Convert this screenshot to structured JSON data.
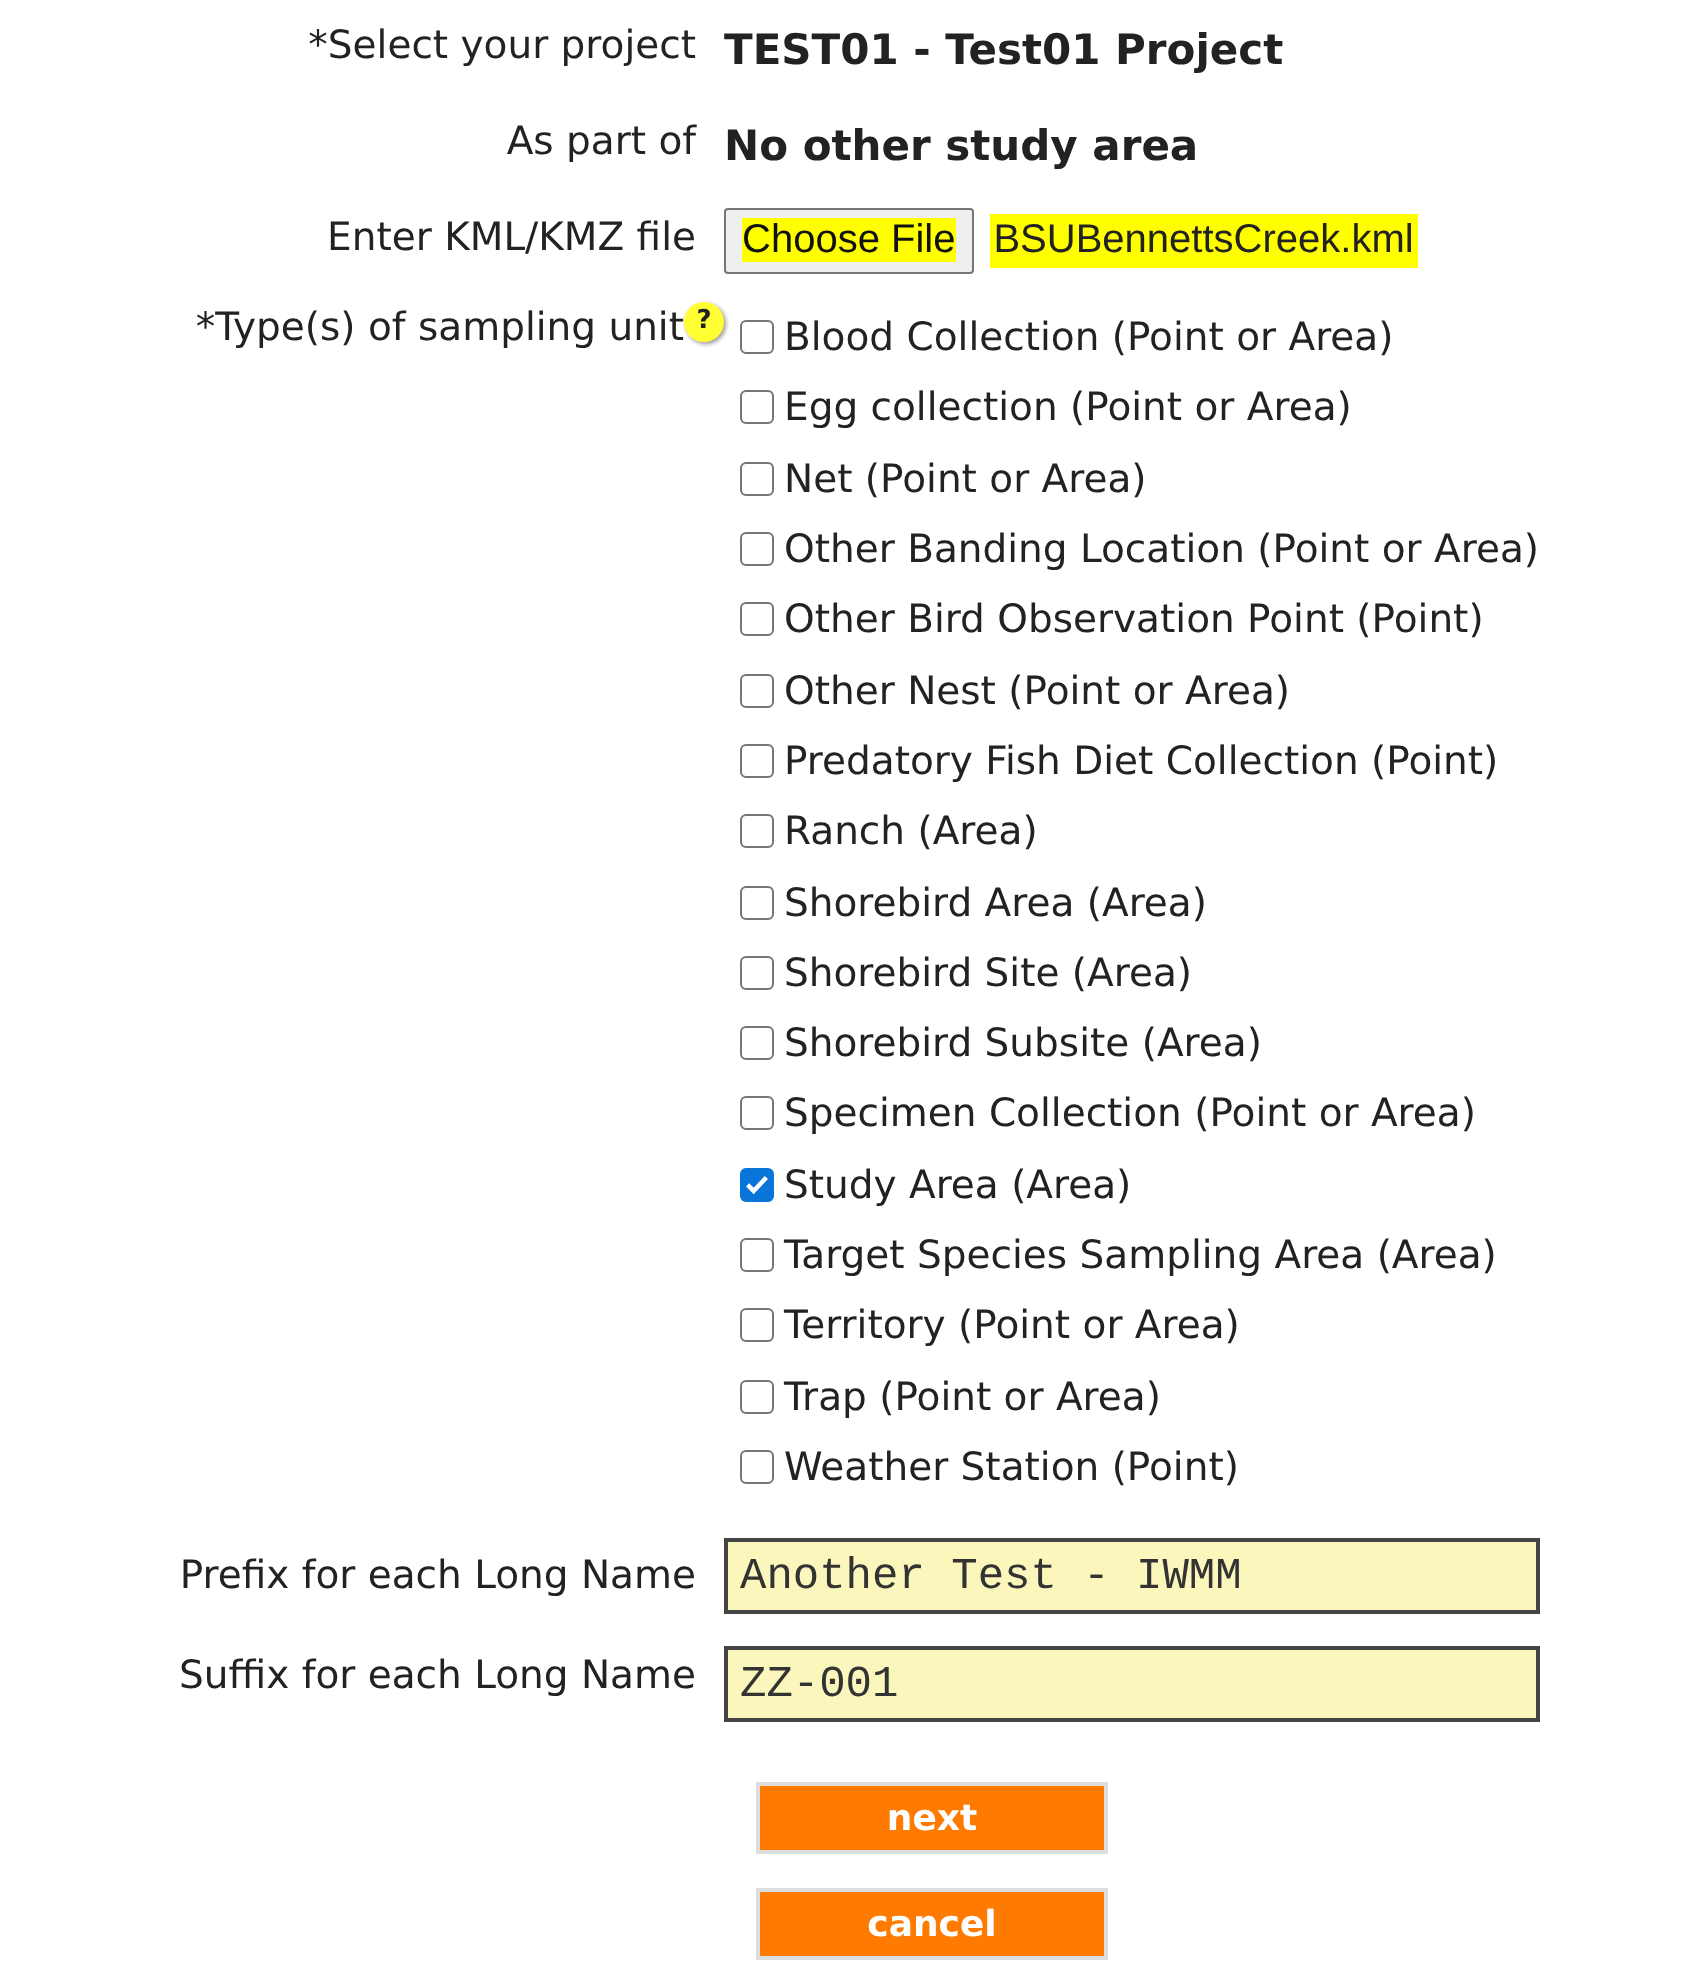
{
  "project": {
    "label": "*Select your project",
    "value": "TEST01 - Test01 Project"
  },
  "part_of": {
    "label": "As part of",
    "value": "No other study area"
  },
  "file": {
    "label": "Enter KML/KMZ file",
    "button": "Choose File",
    "filename": "BSUBennettsCreek.kml"
  },
  "sampling": {
    "label": "*Type(s) of sampling unit",
    "help": "?",
    "options": [
      {
        "label": "Blood Collection (Point or Area)",
        "checked": false
      },
      {
        "label": "Egg collection (Point or Area)",
        "checked": false
      },
      {
        "label": "Net (Point or Area)",
        "checked": false
      },
      {
        "label": "Other Banding Location (Point or Area)",
        "checked": false
      },
      {
        "label": "Other Bird Observation Point (Point)",
        "checked": false
      },
      {
        "label": "Other Nest (Point or Area)",
        "checked": false
      },
      {
        "label": "Predatory Fish Diet Collection (Point)",
        "checked": false
      },
      {
        "label": "Ranch (Area)",
        "checked": false
      },
      {
        "label": "Shorebird Area (Area)",
        "checked": false
      },
      {
        "label": "Shorebird Site (Area)",
        "checked": false
      },
      {
        "label": "Shorebird Subsite (Area)",
        "checked": false
      },
      {
        "label": "Specimen Collection (Point or Area)",
        "checked": false
      },
      {
        "label": "Study Area (Area)",
        "checked": true
      },
      {
        "label": "Target Species Sampling Area (Area)",
        "checked": false
      },
      {
        "label": "Territory (Point or Area)",
        "checked": false
      },
      {
        "label": "Trap (Point or Area)",
        "checked": false
      },
      {
        "label": "Weather Station (Point)",
        "checked": false
      }
    ]
  },
  "prefix": {
    "label": "Prefix for each Long Name",
    "value": "Another Test - IWMM"
  },
  "suffix": {
    "label": "Suffix for each Long Name",
    "value": "ZZ-001"
  },
  "buttons": [
    "next",
    "cancel"
  ]
}
